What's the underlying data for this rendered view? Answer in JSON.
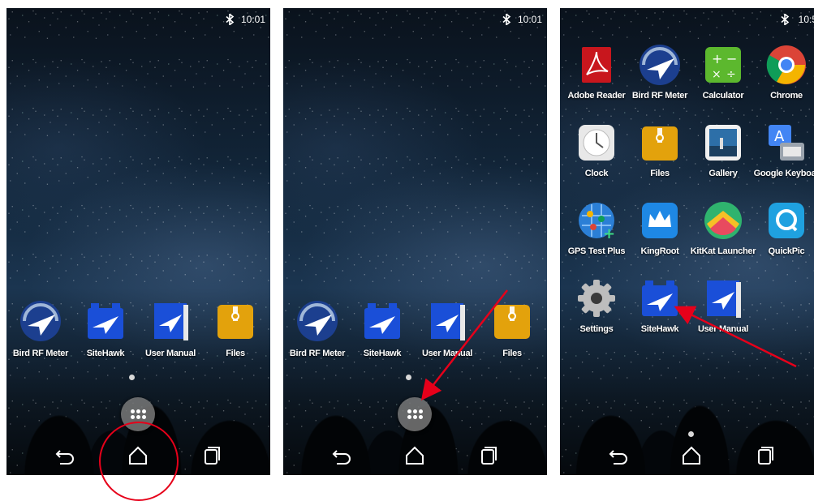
{
  "status": {
    "time": "10:01",
    "time_drawer": "10:5"
  },
  "home_screen": {
    "apps": [
      {
        "label": "Bird RF Meter",
        "icon": "bird-rf-meter-icon"
      },
      {
        "label": "SiteHawk",
        "icon": "sitehawk-icon"
      },
      {
        "label": "User Manual",
        "icon": "user-manual-icon"
      },
      {
        "label": "Files",
        "icon": "files-icon"
      }
    ]
  },
  "app_drawer": {
    "apps": [
      {
        "label": "Adobe Reader",
        "icon": "adobe-reader-icon"
      },
      {
        "label": "Bird RF Meter",
        "icon": "bird-rf-meter-icon"
      },
      {
        "label": "Calculator",
        "icon": "calculator-icon"
      },
      {
        "label": "Chrome",
        "icon": "chrome-icon"
      },
      {
        "label": "Clock",
        "icon": "clock-icon"
      },
      {
        "label": "Files",
        "icon": "files-icon"
      },
      {
        "label": "Gallery",
        "icon": "gallery-icon"
      },
      {
        "label": "Google Keyboar",
        "icon": "keyboard-icon"
      },
      {
        "label": "GPS Test Plus",
        "icon": "gps-icon"
      },
      {
        "label": "KingRoot",
        "icon": "kingroot-icon"
      },
      {
        "label": "KitKat Launcher",
        "icon": "kitkat-launcher-icon"
      },
      {
        "label": "QuickPic",
        "icon": "quickpic-icon"
      },
      {
        "label": "Settings",
        "icon": "settings-icon"
      },
      {
        "label": "SiteHawk",
        "icon": "sitehawk-icon"
      },
      {
        "label": "User Manual",
        "icon": "user-manual-icon"
      }
    ]
  },
  "colors": {
    "annotation": "#e6001a",
    "sitehawk_blue": "#1a4fd8",
    "files_yellow": "#e3a20c"
  }
}
